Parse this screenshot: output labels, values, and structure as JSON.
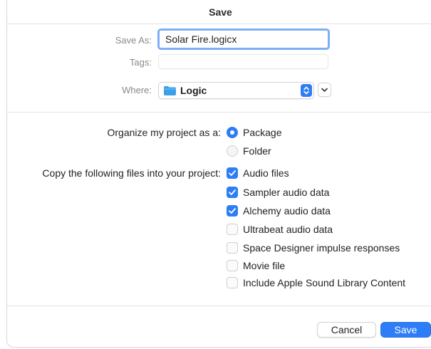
{
  "dialog": {
    "title": "Save"
  },
  "save_as": {
    "label": "Save As:",
    "value": "Solar Fire.logicx"
  },
  "tags": {
    "label": "Tags:",
    "value": ""
  },
  "where": {
    "label": "Where:",
    "value": "Logic",
    "icon": "folder-icon"
  },
  "organize": {
    "label": "Organize my project as a:",
    "options": [
      {
        "label": "Package",
        "selected": true
      },
      {
        "label": "Folder",
        "selected": false
      }
    ]
  },
  "copy": {
    "label": "Copy the following files into your project:",
    "options": [
      {
        "label": "Audio files",
        "checked": true
      },
      {
        "label": "Sampler audio data",
        "checked": true
      },
      {
        "label": "Alchemy audio data",
        "checked": true
      },
      {
        "label": "Ultrabeat audio data",
        "checked": false
      },
      {
        "label": "Space Designer impulse responses",
        "checked": false
      },
      {
        "label": "Movie file",
        "checked": false
      },
      {
        "label": "Include Apple Sound Library Content",
        "checked": false
      }
    ]
  },
  "buttons": {
    "cancel": "Cancel",
    "save": "Save"
  },
  "colors": {
    "accent": "#2d7df6",
    "focus_ring": "#7eaef5",
    "folder": "#3aa0e8"
  }
}
